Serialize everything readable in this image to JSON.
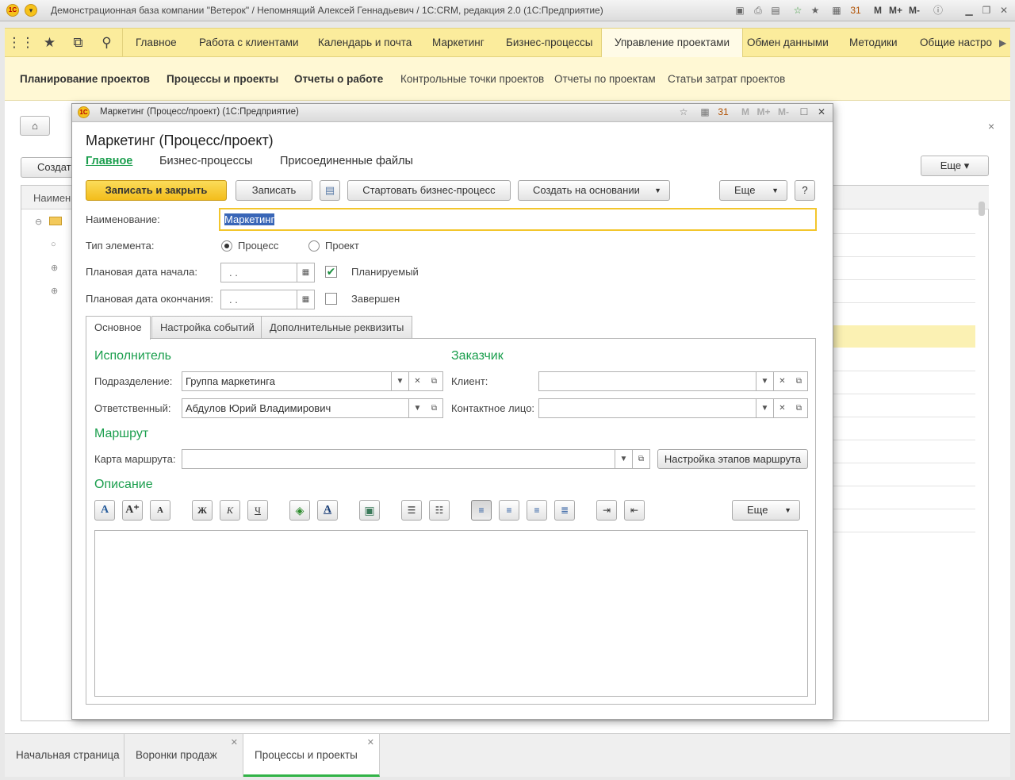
{
  "window": {
    "title": "Демонстрационная база компании \"Ветерок\" / Непомнящий Алексей Геннадьевич / 1C:CRM, редакция 2.0  (1С:Предприятие)",
    "logo": "1C",
    "m": "M",
    "mplus": "M+",
    "mminus": "M-"
  },
  "sections": [
    "Главное",
    "Работа с клиентами",
    "Календарь и почта",
    "Маркетинг",
    "Бизнес-процессы",
    "Управление проектами",
    "Обмен данными",
    "Методики",
    "Общие настро"
  ],
  "sections_active": "Управление проектами",
  "subsections": [
    "Планирование проектов",
    "Процессы и проекты",
    "Отчеты о работе",
    "Контрольные точки проектов",
    "Отчеты по проектам",
    "Статьи затрат проектов"
  ],
  "bg": {
    "create": "Создат",
    "name_col": "Наимен",
    "more": "Еще",
    "close": "×"
  },
  "dialog": {
    "header": "Маркетинг (Процесс/проект)  (1С:Предприятие)",
    "title": "Маркетинг (Процесс/проект)",
    "tabs": [
      "Главное",
      "Бизнес-процессы",
      "Присоединенные файлы"
    ],
    "toolbar": {
      "save_close": "Записать и закрыть",
      "save": "Записать",
      "start_bp": "Стартовать бизнес-процесс",
      "create_based": "Создать на основании",
      "more": "Еще",
      "help": "?"
    },
    "name_label": "Наименование:",
    "name_value": "Маркетинг",
    "type_label": "Тип элемента:",
    "type_process": "Процесс",
    "type_project": "Проект",
    "type_selected": "Процесс",
    "start_label": "Плановая дата начала:",
    "start_value": " .  .",
    "planned_label": "Планируемый",
    "planned_checked": true,
    "end_label": "Плановая дата окончания:",
    "end_value": " .  .",
    "done_label": "Завершен",
    "done_checked": false,
    "inner_tabs": [
      "Основное",
      "Настройка событий",
      "Дополнительные реквизиты"
    ],
    "executor": {
      "title": "Исполнитель",
      "dept_label": "Подразделение:",
      "dept_value": "Группа маркетинга",
      "resp_label": "Ответственный:",
      "resp_value": "Абдулов Юрий Владимирович"
    },
    "customer": {
      "title": "Заказчик",
      "client_label": "Клиент:",
      "client_value": "",
      "contact_label": "Контактное лицо:",
      "contact_value": ""
    },
    "route": {
      "title": "Маршрут",
      "map_label": "Карта маршрута:",
      "map_value": "",
      "setup_btn": "Настройка этапов маршрута"
    },
    "description": {
      "title": "Описание",
      "more": "Еще",
      "bold": "Ж",
      "italic": "К",
      "underline": "Ч"
    }
  },
  "bottom_tabs": [
    "Начальная страница",
    "Воронки продаж",
    "Процессы и проекты"
  ],
  "bottom_active": "Процессы и проекты"
}
